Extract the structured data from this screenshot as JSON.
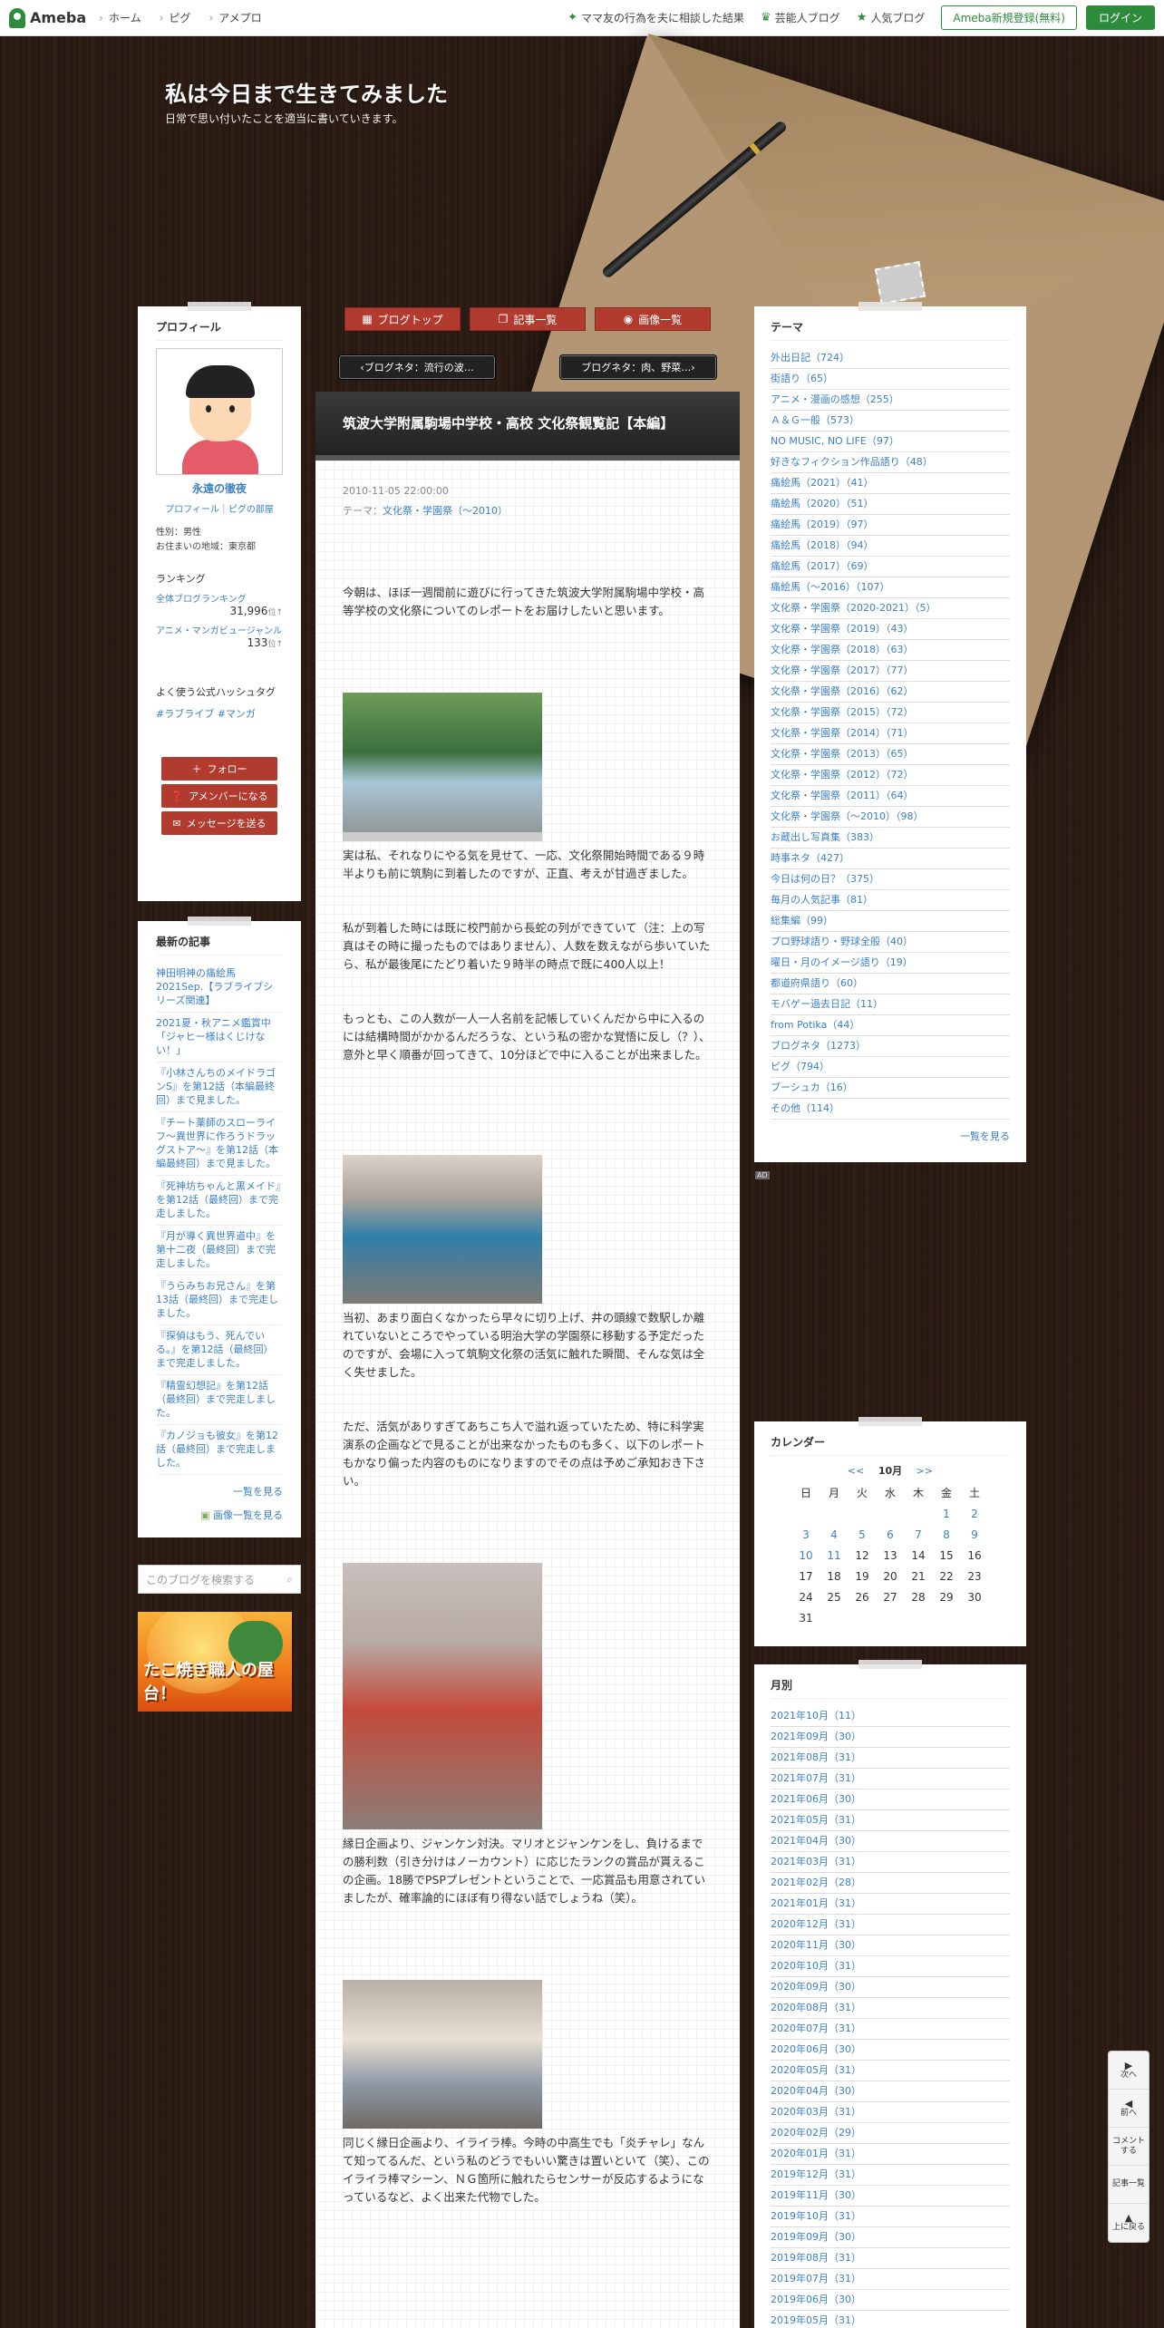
{
  "topbar": {
    "logo": "Ameba",
    "nav": [
      "ホーム",
      "ピグ",
      "アメプロ"
    ],
    "right_links": [
      {
        "label": "ママ友の行為を夫に相談した結果",
        "icon": "sparkle-icon"
      },
      {
        "label": "芸能人ブログ",
        "icon": "crown-icon"
      },
      {
        "label": "人気ブログ",
        "icon": "star-icon"
      }
    ],
    "register": "Ameba新規登録(無料)",
    "login": "ログイン"
  },
  "blog": {
    "title": "私は今日まで生きてみました",
    "description": "日常で思い付いたことを適当に書いていきます。"
  },
  "profile": {
    "heading": "プロフィール",
    "name": "永遠の徹夜",
    "links": "プロフィール｜ピグの部屋",
    "gender": "性別：男性",
    "area": "お住まいの地域：東京都",
    "ranking_title": "ランキング",
    "ranking": [
      {
        "label": "全体ブログランキング",
        "value": "31,996",
        "unit": "位"
      },
      {
        "label": "アニメ・マンガビュージャンル",
        "value": "133",
        "unit": "位"
      }
    ],
    "hashtag_title": "よく使う公式ハッシュタグ",
    "hashtags": "#ラブライブ  #マンガ",
    "buttons": [
      "フォロー",
      "アメンバーになる",
      "メッセージを送る"
    ]
  },
  "recent": {
    "heading": "最新の記事",
    "items": [
      "神田明神の痛絵馬2021Sep.【ラブライブシリーズ関連】",
      "2021夏・秋アニメ鑑賞中「ジャヒー様はくじけない！」",
      "『小林さんちのメイドラゴンS』を第12話（本編最終回）まで見ました。",
      "『チート薬師のスローライフ～異世界に作ろうドラッグストア～』を第12話（本編最終回）まで見ました。",
      "『死神坊ちゃんと黒メイド』を第12話（最終回）まで完走しました。",
      "『月が導く異世界道中』を第十二夜（最終回）まで完走しました。",
      "『うらみちお兄さん』を第13話（最終回）まで完走しました。",
      "『探偵はもう、死んでいる。』を第12話（最終回）まで完走しました。",
      "『精霊幻想記』を第12話（最終回）まで完走しました。",
      "『カノジョも彼女』を第12話（最終回）まで完走しました。"
    ],
    "more": "一覧を見る",
    "more_images": "画像一覧を見る"
  },
  "search": {
    "placeholder": "このブログを検索する"
  },
  "banner": {
    "text": "たこ焼き職人の屋台！"
  },
  "menu": [
    "ブログトップ",
    "記事一覧",
    "画像一覧"
  ],
  "pager": {
    "prev": "ブログネタ：流行の波…",
    "next": "ブログネタ：肉、野菜…"
  },
  "article": {
    "title": "筑波大学附属駒場中学校・高校 文化祭観覧記【本編】",
    "date": "2010-11-05 22:00:00",
    "theme_label": "テーマ：",
    "theme": "文化祭・学園祭（～2010）",
    "p1": "今朝は、ほぼ一週間前に遊びに行ってきた筑波大学附属駒場中学校・高等学校の文化祭についてのレポートをお届けしたいと思います。",
    "p2": "実は私、それなりにやる気を見せて、一応、文化祭開始時間である９時半よりも前に筑駒に到着したのですが、正直、考えが甘過ぎました。",
    "p3": "私が到着した時には既に校門前から長蛇の列ができていて（注：上の写真はその時に撮ったものではありません）、人数を数えながら歩いていたら、私が最後尾にたどり着いた９時半の時点で既に400人以上！",
    "p4": "もっとも、この人数が一人一人名前を記帳していくんだから中に入るのには結構時間がかかるんだろうな、という私の密かな覚悟に反し（？）、意外と早く順番が回ってきて、10分ほどで中に入ることが出来ました。",
    "p5": "当初、あまり面白くなかったら早々に切り上げ、井の頭線で数駅しか離れていないところでやっている明治大学の学園祭に移動する予定だったのですが、会場に入って筑駒文化祭の活気に触れた瞬間、そんな気は全く失せました。",
    "p6": "ただ、活気がありすぎてあちこち人で溢れ返っていたため、特に科学実演系の企画などで見ることが出来なかったものも多く、以下のレポートもかなり偏った内容のものになりますのでその点は予めご承知おき下さい。",
    "p7": "縁日企画より、ジャンケン対決。マリオとジャンケンをし、負けるまでの勝利数（引き分けはノーカウント）に応じたランクの賞品が貰えるこの企画。18勝でPSPプレゼントということで、一応賞品も用意されていましたが、確率論的にほぼ有り得ない話でしょうね（笑）。",
    "p8": "同じく縁日企画より、イライラ棒。今時の中高生でも「炎チャレ」なんて知ってるんだ、という私のどうでもいい驚きは置いといて（笑）、このイライラ棒マシーン、ＮＧ箇所に触れたらセンサーが反応するようになっているなど、よく出来た代物でした。"
  },
  "themes": {
    "heading": "テーマ",
    "items": [
      {
        "name": "外出日記",
        "count": "724"
      },
      {
        "name": "街語り",
        "count": "65"
      },
      {
        "name": "アニメ・漫画の感想",
        "count": "255"
      },
      {
        "name": "Ａ＆Ｇ一般",
        "count": "573"
      },
      {
        "name": "NO MUSIC, NO LIFE",
        "count": "97"
      },
      {
        "name": "好きなフィクション作品語り",
        "count": "48"
      },
      {
        "name": "痛絵馬（2021）",
        "count": "41"
      },
      {
        "name": "痛絵馬（2020）",
        "count": "51"
      },
      {
        "name": "痛絵馬（2019）",
        "count": "97"
      },
      {
        "name": "痛絵馬（2018）",
        "count": "94"
      },
      {
        "name": "痛絵馬（2017）",
        "count": "69"
      },
      {
        "name": "痛絵馬（～2016）",
        "count": "107"
      },
      {
        "name": "文化祭・学園祭（2020-2021）",
        "count": "5"
      },
      {
        "name": "文化祭・学園祭（2019）",
        "count": "43"
      },
      {
        "name": "文化祭・学園祭（2018）",
        "count": "63"
      },
      {
        "name": "文化祭・学園祭（2017）",
        "count": "77"
      },
      {
        "name": "文化祭・学園祭（2016）",
        "count": "62"
      },
      {
        "name": "文化祭・学園祭（2015）",
        "count": "72"
      },
      {
        "name": "文化祭・学園祭（2014）",
        "count": "71"
      },
      {
        "name": "文化祭・学園祭（2013）",
        "count": "65"
      },
      {
        "name": "文化祭・学園祭（2012）",
        "count": "72"
      },
      {
        "name": "文化祭・学園祭（2011）",
        "count": "64"
      },
      {
        "name": "文化祭・学園祭（～2010）",
        "count": "98"
      },
      {
        "name": "お蔵出し写真集",
        "count": "383"
      },
      {
        "name": "時事ネタ",
        "count": "427"
      },
      {
        "name": "今日は何の日？",
        "count": "375"
      },
      {
        "name": "毎月の人気記事",
        "count": "81"
      },
      {
        "name": "総集編",
        "count": "99"
      },
      {
        "name": "プロ野球語り・野球全般",
        "count": "40"
      },
      {
        "name": "曜日・月のイメージ語り",
        "count": "19"
      },
      {
        "name": "都道府県語り",
        "count": "60"
      },
      {
        "name": "モバゲー過去日記",
        "count": "11"
      },
      {
        "name": "from Potika",
        "count": "44"
      },
      {
        "name": "ブログネタ",
        "count": "1273"
      },
      {
        "name": "ピグ",
        "count": "794"
      },
      {
        "name": "ブーシュカ",
        "count": "16"
      },
      {
        "name": "その他",
        "count": "114"
      }
    ],
    "more": "一覧を見る"
  },
  "ad_tag": "AD",
  "calendar": {
    "heading": "カレンダー",
    "prev": "<<",
    "month": "10月",
    "next": ">>",
    "weekdays": [
      "日",
      "月",
      "火",
      "水",
      "木",
      "金",
      "土"
    ],
    "days": [
      "",
      "",
      "",
      "",
      "",
      "1",
      "2",
      "3",
      "4",
      "5",
      "6",
      "7",
      "8",
      "9",
      "10",
      "11",
      "12",
      "13",
      "14",
      "15",
      "16",
      "17",
      "18",
      "19",
      "20",
      "21",
      "22",
      "23",
      "24",
      "25",
      "26",
      "27",
      "28",
      "29",
      "30",
      "31"
    ],
    "linked_days": [
      "1",
      "2",
      "3",
      "4",
      "5",
      "6",
      "7",
      "8",
      "9",
      "10",
      "11"
    ]
  },
  "monthly": {
    "heading": "月別",
    "items": [
      "2021年10月（11）",
      "2021年09月（30）",
      "2021年08月（31）",
      "2021年07月（31）",
      "2021年06月（30）",
      "2021年05月（31）",
      "2021年04月（30）",
      "2021年03月（31）",
      "2021年02月（28）",
      "2021年01月（31）",
      "2020年12月（31）",
      "2020年11月（30）",
      "2020年10月（31）",
      "2020年09月（30）",
      "2020年08月（31）",
      "2020年07月（31）",
      "2020年06月（30）",
      "2020年05月（31）",
      "2020年04月（30）",
      "2020年03月（31）",
      "2020年02月（29）",
      "2020年01月（31）",
      "2019年12月（31）",
      "2019年11月（30）",
      "2019年10月（31）",
      "2019年09月（30）",
      "2019年08月（31）",
      "2019年07月（31）",
      "2019年06月（30）",
      "2019年05月（31）"
    ]
  },
  "floatnav": [
    {
      "label": "次へ",
      "icon": "▶"
    },
    {
      "label": "前へ",
      "icon": "◀"
    },
    {
      "label": "コメントする",
      "icon": ""
    },
    {
      "label": "記事一覧",
      "icon": ""
    },
    {
      "label": "上に戻る",
      "icon": "▲"
    }
  ]
}
